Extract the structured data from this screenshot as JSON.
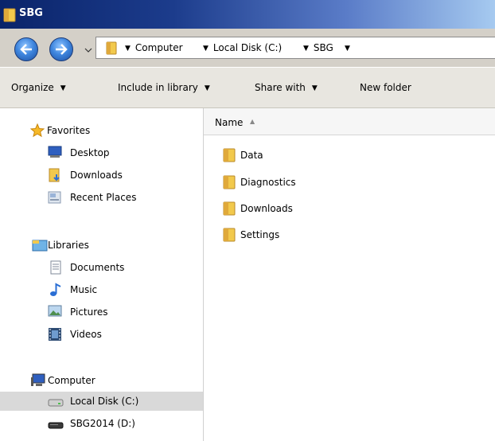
{
  "window": {
    "title": "SBG"
  },
  "address": {
    "crumbs": [
      "Computer",
      "Local Disk (C:)",
      "SBG"
    ]
  },
  "toolbar": {
    "organize": "Organize",
    "include": "Include in library",
    "share": "Share with",
    "new_folder": "New folder"
  },
  "nav": {
    "favorites": {
      "label": "Favorites",
      "icon": "star-icon"
    },
    "fav_items": [
      {
        "label": "Desktop",
        "icon": "desktop-icon"
      },
      {
        "label": "Downloads",
        "icon": "downloads-folder-icon"
      },
      {
        "label": "Recent Places",
        "icon": "recent-places-icon"
      }
    ],
    "libraries": {
      "label": "Libraries",
      "icon": "libraries-icon"
    },
    "lib_items": [
      {
        "label": "Documents",
        "icon": "documents-icon"
      },
      {
        "label": "Music",
        "icon": "music-icon"
      },
      {
        "label": "Pictures",
        "icon": "pictures-icon"
      },
      {
        "label": "Videos",
        "icon": "videos-icon"
      }
    ],
    "computer": {
      "label": "Computer",
      "icon": "computer-icon"
    },
    "drives": [
      {
        "label": "Local Disk (C:)",
        "icon": "hard-drive-icon",
        "selected": true
      },
      {
        "label": "SBG2014 (D:)",
        "icon": "optical-drive-icon",
        "selected": false
      }
    ]
  },
  "content": {
    "column_name": "Name",
    "files": [
      {
        "name": "Data",
        "icon": "folder-icon"
      },
      {
        "name": "Diagnostics",
        "icon": "folder-icon"
      },
      {
        "name": "Downloads",
        "icon": "folder-icon"
      },
      {
        "name": "Settings",
        "icon": "folder-icon"
      }
    ]
  },
  "colors": {
    "folder": "#f2c94c",
    "selection": "#d9d9d9",
    "title_start": "#0a246a",
    "title_end": "#a6caf0"
  }
}
